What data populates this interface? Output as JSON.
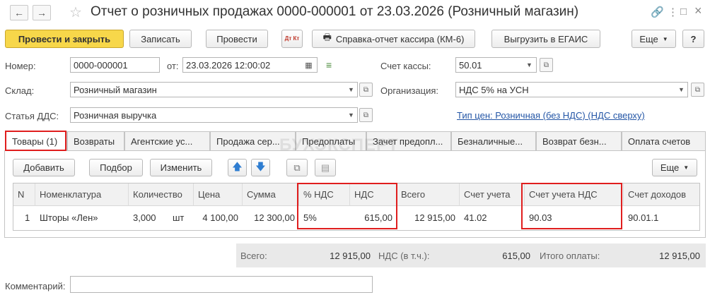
{
  "window": {
    "title": "Отчет о розничных продажах 0000-000001 от 23.03.2026 (Розничный магазин)",
    "back_icon": "←",
    "forward_icon": "→",
    "star_icon": "☆",
    "link_icon": "🔗",
    "more_icon": "⋮",
    "restore_icon": "□",
    "close_icon": "×"
  },
  "toolbar": {
    "post_close": "Провести и закрыть",
    "save": "Записать",
    "post": "Провести",
    "dtkt": "Дт Кт",
    "report_icon": "🖶",
    "report": "Справка-отчет кассира (КМ-6)",
    "egais": "Выгрузить в ЕГАИС",
    "more": "Еще",
    "help": "?"
  },
  "form": {
    "number_label": "Номер:",
    "number_value": "0000-000001",
    "date_label": "от:",
    "date_value": "23.03.2026 12:00:02",
    "cashacc_label": "Счет кассы:",
    "cashacc_value": "50.01",
    "warehouse_label": "Склад:",
    "warehouse_value": "Розничный магазин",
    "org_label": "Организация:",
    "org_value": "НДС 5% на УСН",
    "dds_label": "Статья ДДС:",
    "dds_value": "Розничная выручка",
    "price_type_link": "Тип цен: Розничная (без НДС) (НДС сверху)"
  },
  "tabs": [
    "Товары (1)",
    "Возвраты",
    "Агентские ус...",
    "Продажа сер...",
    "Предоплаты",
    "Зачет предопл...",
    "Безналичные...",
    "Возврат безн...",
    "Оплата счетов"
  ],
  "watermark": "БУХЭКСПЕРТ",
  "table_toolbar": {
    "add": "Добавить",
    "select": "Подбор",
    "edit": "Изменить",
    "up": "🡅",
    "down": "🡇",
    "copy_icon": "⧉",
    "paste_icon": "▤",
    "more": "Еще"
  },
  "table": {
    "headers": [
      "N",
      "Номенклатура",
      "Количество",
      "Цена",
      "Сумма",
      "% НДС",
      "НДС",
      "Всего",
      "Счет учета",
      "Счет учета НДС",
      "Счет доходов"
    ],
    "rows": [
      {
        "n": "1",
        "item": "Шторы «Лен»",
        "qty": "3,000",
        "unit": "шт",
        "price": "4 100,00",
        "sum": "12 300,00",
        "vat_rate": "5%",
        "vat": "615,00",
        "total": "12 915,00",
        "account": "41.02",
        "vat_account": "90.03",
        "income_account": "90.01.1"
      }
    ]
  },
  "totals": {
    "total_label": "Всего:",
    "total_value": "12 915,00",
    "vat_label": "НДС (в т.ч.):",
    "vat_value": "615,00",
    "payment_label": "Итого оплаты:",
    "payment_value": "12 915,00"
  },
  "footer": {
    "comment_label": "Комментарий:",
    "comment_value": ""
  },
  "colors": {
    "primary_button": "#f7d74a",
    "highlight": "#e01e1e",
    "link": "#2456a6"
  }
}
